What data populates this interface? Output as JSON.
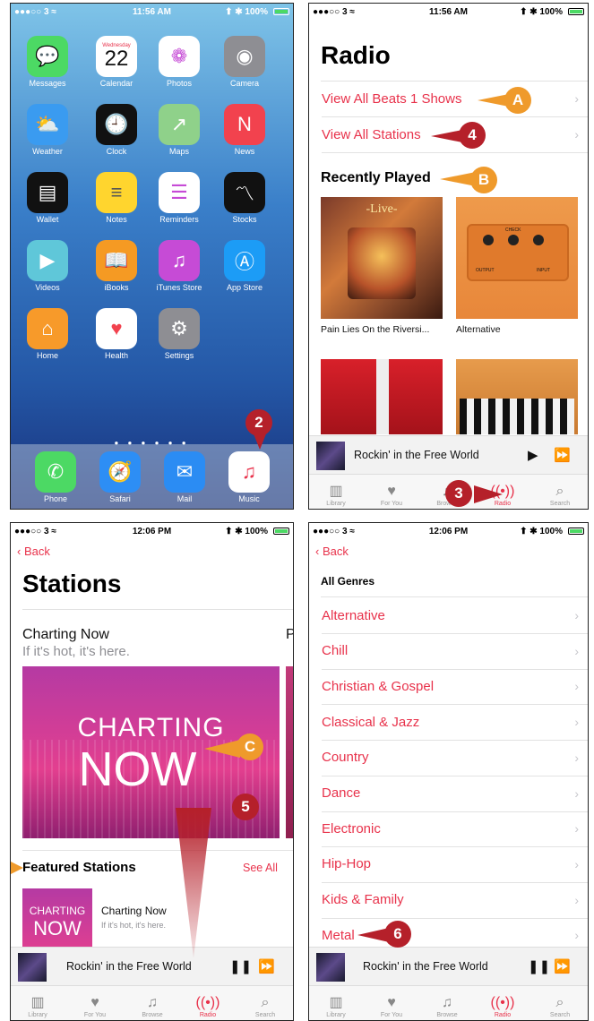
{
  "screen1": {
    "status": {
      "carrier": "●●●○○ 3 ≈",
      "time": "11:56 AM",
      "battery": "⬆ ✱ 100%"
    },
    "apps": [
      {
        "label": "Messages",
        "icon": "messages-icon",
        "color": "#4cd964",
        "glyph": "💬"
      },
      {
        "label": "Calendar",
        "icon": "calendar-icon",
        "color": "#ffffff",
        "glyph": ""
      },
      {
        "label": "Photos",
        "icon": "photos-icon",
        "color": "#ffffff",
        "glyph": "❁"
      },
      {
        "label": "Camera",
        "icon": "camera-icon",
        "color": "#8e8e93",
        "glyph": "◉"
      },
      {
        "label": "Weather",
        "icon": "weather-icon",
        "color": "#3a9bf0",
        "glyph": "⛅"
      },
      {
        "label": "Clock",
        "icon": "clock-icon",
        "color": "#111111",
        "glyph": "🕘"
      },
      {
        "label": "Maps",
        "icon": "maps-icon",
        "color": "#8fd18a",
        "glyph": "↗"
      },
      {
        "label": "News",
        "icon": "news-icon",
        "color": "#f2424e",
        "glyph": "N"
      },
      {
        "label": "Wallet",
        "icon": "wallet-icon",
        "color": "#111111",
        "glyph": "▤"
      },
      {
        "label": "Notes",
        "icon": "notes-icon",
        "color": "#ffd52e",
        "glyph": "≡"
      },
      {
        "label": "Reminders",
        "icon": "reminders-icon",
        "color": "#ffffff",
        "glyph": "☰"
      },
      {
        "label": "Stocks",
        "icon": "stocks-icon",
        "color": "#111111",
        "glyph": "〽"
      },
      {
        "label": "Videos",
        "icon": "videos-icon",
        "color": "#5fc7d9",
        "glyph": "▶"
      },
      {
        "label": "iBooks",
        "icon": "ibooks-icon",
        "color": "#f59a23",
        "glyph": "📖"
      },
      {
        "label": "iTunes Store",
        "icon": "itunes-store-icon",
        "color": "#c64bd6",
        "glyph": "♫"
      },
      {
        "label": "App Store",
        "icon": "app-store-icon",
        "color": "#1c9cf6",
        "glyph": "Ⓐ"
      },
      {
        "label": "Home",
        "icon": "home-icon",
        "color": "#f79a2a",
        "glyph": "⌂"
      },
      {
        "label": "Health",
        "icon": "health-icon",
        "color": "#ffffff",
        "glyph": "♥"
      },
      {
        "label": "Settings",
        "icon": "settings-icon",
        "color": "#8e8e93",
        "glyph": "⚙"
      }
    ],
    "calendar": {
      "weekday": "Wednesday",
      "day": "22"
    },
    "dock": [
      {
        "label": "Phone",
        "icon": "phone-icon",
        "color": "#4cd964",
        "glyph": "✆"
      },
      {
        "label": "Safari",
        "icon": "safari-icon",
        "color": "#2d8ef5",
        "glyph": "🧭"
      },
      {
        "label": "Mail",
        "icon": "mail-icon",
        "color": "#2b8cf3",
        "glyph": "✉"
      },
      {
        "label": "Music",
        "icon": "music-icon",
        "color": "#ffffff",
        "glyph": "♫"
      }
    ],
    "step": "2"
  },
  "screen2": {
    "status": {
      "carrier": "●●●○○ 3 ≈",
      "time": "11:56 AM",
      "battery": "⬆ ✱ 100%"
    },
    "title": "Radio",
    "links": [
      "View All Beats 1 Shows",
      "View All Stations"
    ],
    "section": "Recently Played",
    "tiles": [
      "Pain Lies On the Riversi...",
      "Alternative"
    ],
    "album_text": "-Live-",
    "pedal_text": {
      "check": "CHECK",
      "output": "OUTPUT",
      "input": "INPUT"
    },
    "callouts": {
      "a": "A",
      "four": "4",
      "b": "B",
      "three": "3"
    },
    "player": {
      "title": "Rockin' in the Free World"
    },
    "tabs": [
      "Library",
      "For You",
      "Browse",
      "Radio",
      "Search"
    ]
  },
  "screen3": {
    "status": {
      "carrier": "●●●○○ 3 ≈",
      "time": "12:06 PM",
      "battery": "⬆ ✱ 100%"
    },
    "back": "Back",
    "title": "Stations",
    "card_title": "Charting Now",
    "card_sub": "If it's hot, it's here.",
    "next_peek": "P",
    "banner": [
      "CHARTING",
      "NOW"
    ],
    "featured": "Featured Stations",
    "see_all": "See All",
    "item_title": "Charting Now",
    "item_sub": "If it's hot, it's here.",
    "item_art": [
      "CHARTING",
      "NOW"
    ],
    "callouts": {
      "c": "C",
      "five": "5"
    },
    "player": {
      "title": "Rockin' in the Free World"
    },
    "tabs": [
      "Library",
      "For You",
      "Browse",
      "Radio",
      "Search"
    ]
  },
  "screen4": {
    "status": {
      "carrier": "●●●○○ 3 ≈",
      "time": "12:06 PM",
      "battery": "⬆ ✱ 100%"
    },
    "back": "Back",
    "header": "All Genres",
    "genres": [
      "Alternative",
      "Chill",
      "Christian & Gospel",
      "Classical & Jazz",
      "Country",
      "Dance",
      "Electronic",
      "Hip-Hop",
      "Kids & Family",
      "Metal"
    ],
    "callouts": {
      "six": "6"
    },
    "player": {
      "title": "Rockin' in the Free World"
    },
    "tabs": [
      "Library",
      "For You",
      "Browse",
      "Radio",
      "Search"
    ]
  },
  "colors": {
    "accent": "#e8324b",
    "callout_red": "#b5202a",
    "callout_orange": "#ef9a2b"
  }
}
